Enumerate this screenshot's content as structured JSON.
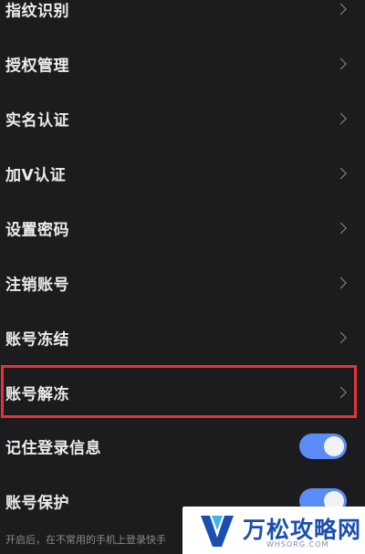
{
  "settings": {
    "rows": [
      {
        "label": "指纹识别",
        "type": "link"
      },
      {
        "label": "授权管理",
        "type": "link"
      },
      {
        "label": "实名认证",
        "type": "link"
      },
      {
        "label": "加V认证",
        "type": "link"
      },
      {
        "label": "设置密码",
        "type": "link"
      },
      {
        "label": "注销账号",
        "type": "link"
      },
      {
        "label": "账号冻结",
        "type": "link"
      },
      {
        "label": "账号解冻",
        "type": "link",
        "highlighted": true
      },
      {
        "label": "记住登录信息",
        "type": "toggle",
        "on": true
      },
      {
        "label": "账号保护",
        "type": "toggle",
        "on": true
      }
    ],
    "footer_note": "开启后，在不常用的手机上登录快手"
  },
  "watermark": {
    "title": "万松攻略网",
    "url": "WHSORG.COM"
  },
  "colors": {
    "background": "#1c1c1e",
    "text": "#ececec",
    "toggle_on": "#5b8cf5",
    "highlight": "#e0343c",
    "watermark_blue": "#1a4fb0"
  }
}
